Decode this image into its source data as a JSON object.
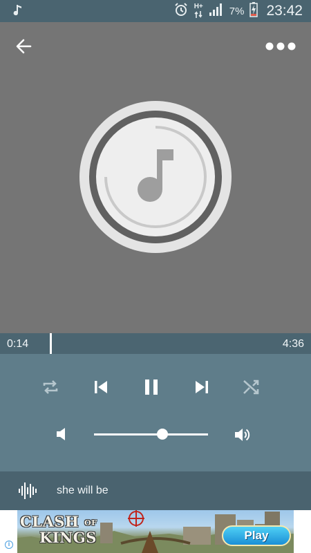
{
  "status_bar": {
    "network_label": "H+",
    "battery_percent": "7%",
    "time": "23:42",
    "icons": [
      "music-note-icon",
      "alarm-icon",
      "data-arrows-icon",
      "signal-icon",
      "battery-charging-icon"
    ]
  },
  "player": {
    "current_time": "0:14",
    "total_time": "4:36",
    "progress_fraction": 0.05,
    "volume_fraction": 0.6,
    "shuffle_enabled": false,
    "repeat_enabled": false,
    "state": "playing"
  },
  "now_playing": {
    "title": "she will be"
  },
  "ad": {
    "logo_line1": "CLASH",
    "logo_of": "OF",
    "logo_line2": "KINGS",
    "play_label": "Play",
    "info_label": "i"
  },
  "colors": {
    "status_bar": "#4a6470",
    "art_background": "#757575",
    "progress_bar": "#4b6571",
    "controls_background": "#5f7d8a",
    "now_playing_bar": "#4a636f"
  }
}
